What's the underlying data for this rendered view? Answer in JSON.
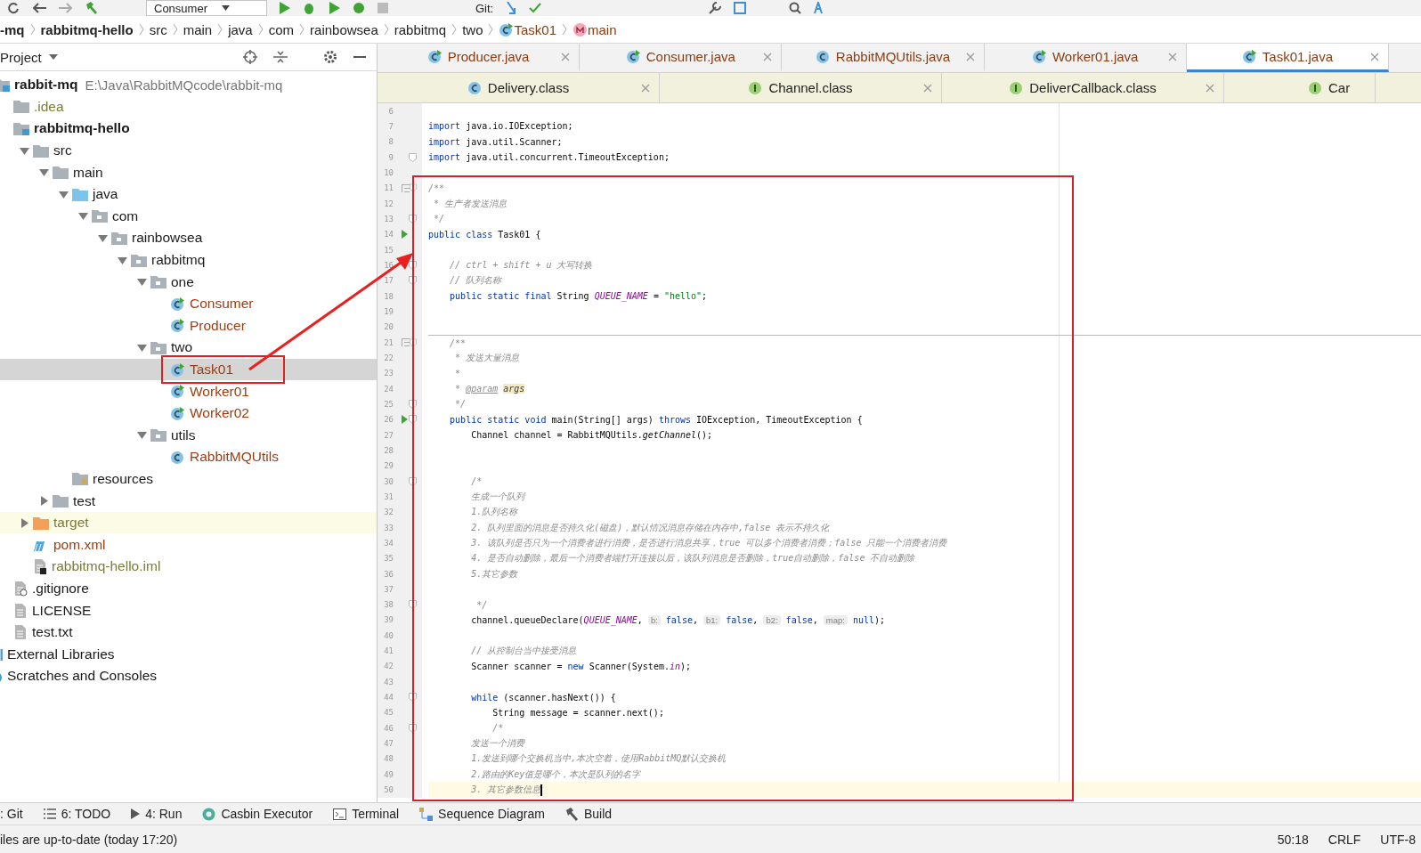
{
  "toolbar": {
    "run_config": "Consumer",
    "vcs_label": "Git:"
  },
  "breadcrumbs": [
    {
      "label": "-mq",
      "kind": "module"
    },
    {
      "label": "rabbitmq-hello",
      "kind": "module"
    },
    {
      "label": "src",
      "kind": "folder"
    },
    {
      "label": "main",
      "kind": "folder"
    },
    {
      "label": "java",
      "kind": "folder"
    },
    {
      "label": "com",
      "kind": "folder"
    },
    {
      "label": "rainbowsea",
      "kind": "folder"
    },
    {
      "label": "rabbitmq",
      "kind": "folder"
    },
    {
      "label": "two",
      "kind": "folder"
    },
    {
      "label": "Task01",
      "kind": "class"
    },
    {
      "label": "main",
      "kind": "method"
    }
  ],
  "project_panel": {
    "title": "Project",
    "tree": [
      {
        "name": "rabbit-mq",
        "kind": "module",
        "path": "E:\\Java\\RabbitMQcode\\rabbit-mq",
        "bold": true,
        "color": "#1a1a1a",
        "selected": false,
        "children": [
          {
            "name": ".idea",
            "kind": "folder",
            "color": "#7c7a3a",
            "selected": false
          },
          {
            "name": "rabbitmq-hello",
            "kind": "module",
            "bold": true,
            "color": "#1a1a1a",
            "selected": false,
            "children": [
              {
                "name": "src",
                "kind": "folder",
                "expanded": true,
                "color": "#1a1a1a",
                "selected": false,
                "children": [
                  {
                    "name": "main",
                    "kind": "folder",
                    "expanded": true,
                    "color": "#1a1a1a",
                    "selected": false,
                    "children": [
                      {
                        "name": "java",
                        "kind": "source-folder",
                        "expanded": true,
                        "color": "#1a1a1a",
                        "selected": false,
                        "children": [
                          {
                            "name": "com",
                            "kind": "package",
                            "expanded": true,
                            "color": "#1a1a1a",
                            "selected": false,
                            "children": [
                              {
                                "name": "rainbowsea",
                                "kind": "package",
                                "expanded": true,
                                "color": "#1a1a1a",
                                "selected": false,
                                "children": [
                                  {
                                    "name": "rabbitmq",
                                    "kind": "package",
                                    "expanded": true,
                                    "color": "#1a1a1a",
                                    "selected": false,
                                    "children": [
                                      {
                                        "name": "one",
                                        "kind": "package",
                                        "expanded": true,
                                        "color": "#1a1a1a",
                                        "selected": false,
                                        "children": [
                                          {
                                            "name": "Consumer",
                                            "kind": "class-runnable",
                                            "color": "#9c3d10",
                                            "selected": false
                                          },
                                          {
                                            "name": "Producer",
                                            "kind": "class-runnable",
                                            "color": "#9c3d10",
                                            "selected": false
                                          }
                                        ]
                                      },
                                      {
                                        "name": "two",
                                        "kind": "package",
                                        "expanded": true,
                                        "color": "#1a1a1a",
                                        "selected": false,
                                        "children": [
                                          {
                                            "name": "Task01",
                                            "kind": "class-runnable",
                                            "color": "#9c3d10",
                                            "selected": true
                                          },
                                          {
                                            "name": "Worker01",
                                            "kind": "class-runnable",
                                            "color": "#9c3d10",
                                            "selected": false
                                          },
                                          {
                                            "name": "Worker02",
                                            "kind": "class-runnable",
                                            "color": "#9c3d10",
                                            "selected": false
                                          }
                                        ]
                                      },
                                      {
                                        "name": "utils",
                                        "kind": "package",
                                        "expanded": true,
                                        "color": "#1a1a1a",
                                        "selected": false,
                                        "children": [
                                          {
                                            "name": "RabbitMQUtils",
                                            "kind": "class",
                                            "color": "#9c3d10",
                                            "selected": false
                                          }
                                        ]
                                      }
                                    ]
                                  }
                                ]
                              }
                            ]
                          }
                        ]
                      },
                      {
                        "name": "resources",
                        "kind": "resources",
                        "color": "#1a1a1a",
                        "selected": false
                      }
                    ]
                  },
                  {
                    "name": "test",
                    "kind": "folder",
                    "expanded": false,
                    "color": "#1a1a1a",
                    "selected": false
                  }
                ]
              },
              {
                "name": "target",
                "kind": "excluded-folder",
                "expanded": false,
                "color": "#7c7a3a",
                "selected": false
              },
              {
                "name": "pom.xml",
                "kind": "maven",
                "color": "#9c3d10",
                "selected": false
              },
              {
                "name": "rabbitmq-hello.iml",
                "kind": "iml",
                "color": "#7c7a3a",
                "selected": false
              }
            ]
          },
          {
            "name": ".gitignore",
            "kind": "gitignore",
            "color": "#1a1a1a",
            "selected": false
          },
          {
            "name": "LICENSE",
            "kind": "text",
            "color": "#1a1a1a",
            "selected": false
          },
          {
            "name": "test.txt",
            "kind": "text",
            "color": "#1a1a1a",
            "selected": false
          }
        ]
      },
      {
        "name": "External Libraries",
        "kind": "library",
        "color": "#1a1a1a",
        "selected": false
      },
      {
        "name": "Scratches and Consoles",
        "kind": "scratches",
        "color": "#1a1a1a",
        "selected": false
      }
    ]
  },
  "editor_tabs": [
    {
      "label": "Producer.java",
      "kind": "runnable",
      "selected": false
    },
    {
      "label": "Consumer.java",
      "kind": "runnable",
      "selected": false
    },
    {
      "label": "RabbitMQUtils.java",
      "kind": "class",
      "selected": false
    },
    {
      "label": "Worker01.java",
      "kind": "runnable",
      "selected": false
    },
    {
      "label": "Task01.java",
      "kind": "runnable",
      "selected": true
    }
  ],
  "library_tabs": [
    {
      "label": "Delivery.class",
      "kind": "class"
    },
    {
      "label": "Channel.class",
      "kind": "interface"
    },
    {
      "label": "DeliverCallback.class",
      "kind": "interface"
    },
    {
      "label": "Car",
      "kind": "interface"
    }
  ],
  "code_lines": [
    {
      "number": "6"
    },
    {
      "number": "7",
      "segments": [
        {
          "kind": "keyword",
          "text": "import"
        },
        {
          "kind": "plain",
          "text": " java.io.IOException;"
        }
      ]
    },
    {
      "number": "8",
      "segments": [
        {
          "kind": "keyword",
          "text": "import"
        },
        {
          "kind": "plain",
          "text": " java.util.Scanner;"
        }
      ]
    },
    {
      "number": "9",
      "markers": [
        {
          "kind": "fold"
        }
      ],
      "segments": [
        {
          "kind": "keyword",
          "text": "import"
        },
        {
          "kind": "plain",
          "text": " java.util.concurrent.TimeoutException;"
        }
      ]
    },
    {
      "number": "10"
    },
    {
      "number": "11",
      "markers": [
        {
          "kind": "doc"
        },
        {
          "kind": "fold"
        }
      ],
      "segments": [
        {
          "kind": "comment",
          "text": "/**"
        }
      ]
    },
    {
      "number": "12",
      "segments": [
        {
          "kind": "comment",
          "text": " * 生产者发送消息"
        }
      ]
    },
    {
      "number": "13",
      "markers": [
        {
          "kind": "fold"
        }
      ],
      "segments": [
        {
          "kind": "comment",
          "text": " */"
        }
      ]
    },
    {
      "number": "14",
      "markers": [
        {
          "kind": "run"
        }
      ],
      "segments": [
        {
          "kind": "keyword",
          "text": "public class"
        },
        {
          "kind": "plain",
          "text": " Task01 {"
        }
      ]
    },
    {
      "number": "15"
    },
    {
      "number": "16",
      "markers": [
        {
          "kind": "fold"
        }
      ],
      "segments": [
        {
          "kind": "comment",
          "text": "    // ctrl + shift + u 大写转换"
        }
      ]
    },
    {
      "number": "17",
      "markers": [
        {
          "kind": "fold"
        }
      ],
      "segments": [
        {
          "kind": "comment",
          "text": "    // 队列名称"
        }
      ]
    },
    {
      "number": "18",
      "segments": [
        {
          "kind": "keyword",
          "text": "    public static final"
        },
        {
          "kind": "plain",
          "text": " String "
        },
        {
          "kind": "constant",
          "text": "QUEUE_NAME"
        },
        {
          "kind": "plain",
          "text": " = "
        },
        {
          "kind": "string",
          "text": "\"hello\""
        },
        {
          "kind": "plain",
          "text": ";"
        }
      ]
    },
    {
      "number": "19"
    },
    {
      "number": "20"
    },
    {
      "number": "21",
      "markers": [
        {
          "kind": "separator"
        },
        {
          "kind": "doc"
        },
        {
          "kind": "fold"
        }
      ],
      "segments": [
        {
          "kind": "comment",
          "text": "    /**"
        }
      ]
    },
    {
      "number": "22",
      "segments": [
        {
          "kind": "comment",
          "text": "     * 发送大量消息"
        }
      ]
    },
    {
      "number": "23",
      "segments": [
        {
          "kind": "comment",
          "text": "     *"
        }
      ]
    },
    {
      "number": "24",
      "segments": [
        {
          "kind": "comment",
          "text": "     * "
        },
        {
          "kind": "doctag",
          "text": "@param"
        },
        {
          "kind": "param",
          "text": "args"
        }
      ]
    },
    {
      "number": "25",
      "markers": [
        {
          "kind": "fold"
        }
      ],
      "segments": [
        {
          "kind": "comment",
          "text": "     */"
        }
      ]
    },
    {
      "number": "26",
      "markers": [
        {
          "kind": "run"
        },
        {
          "kind": "fold"
        }
      ],
      "segments": [
        {
          "kind": "keyword",
          "text": "    public static void"
        },
        {
          "kind": "plain",
          "text": " main(String[] args) "
        },
        {
          "kind": "keyword",
          "text": "throws"
        },
        {
          "kind": "plain",
          "text": " IOException, TimeoutException {"
        }
      ]
    },
    {
      "number": "27",
      "segments": [
        {
          "kind": "plain",
          "text": "        Channel channel = RabbitMQUtils."
        },
        {
          "kind": "method",
          "text": "getChannel"
        },
        {
          "kind": "plain",
          "text": "();"
        }
      ]
    },
    {
      "number": "28"
    },
    {
      "number": "29"
    },
    {
      "number": "30",
      "markers": [
        {
          "kind": "fold"
        }
      ],
      "segments": [
        {
          "kind": "comment",
          "text": "        /*"
        }
      ]
    },
    {
      "number": "31",
      "segments": [
        {
          "kind": "comment",
          "text": "        生成一个队列"
        }
      ]
    },
    {
      "number": "32",
      "segments": [
        {
          "kind": "comment",
          "text": "        1.队列名称"
        }
      ]
    },
    {
      "number": "33",
      "segments": [
        {
          "kind": "comment",
          "text": "        2. 队列里面的消息是否持久化(磁盘)，默认情况消息存储在内存中,false 表示不持久化"
        }
      ]
    },
    {
      "number": "34",
      "segments": [
        {
          "kind": "comment",
          "text": "        3. 该队列是否只为一个消费者进行消费，是否进行消息共享，true 可以多个消费者消费；false 只能一个消费者消费"
        }
      ]
    },
    {
      "number": "35",
      "segments": [
        {
          "kind": "comment",
          "text": "        4. 是否自动删除，最后一个消费者端打开连接以后，该队列消息是否删除，true自动删除，false 不自动删除"
        }
      ]
    },
    {
      "number": "36",
      "segments": [
        {
          "kind": "comment",
          "text": "        5.其它参数"
        }
      ]
    },
    {
      "number": "37"
    },
    {
      "number": "38",
      "markers": [
        {
          "kind": "fold"
        }
      ],
      "segments": [
        {
          "kind": "comment",
          "text": "         */"
        }
      ]
    },
    {
      "number": "39",
      "segments": [
        {
          "kind": "plain",
          "text": "        channel.queueDeclare("
        },
        {
          "kind": "constant",
          "text": "QUEUE_NAME"
        },
        {
          "kind": "plain",
          "text": ", "
        },
        {
          "kind": "hint",
          "text": "b:"
        },
        {
          "kind": "keyword",
          "text": " false"
        },
        {
          "kind": "plain",
          "text": ", "
        },
        {
          "kind": "hint",
          "text": "b1:"
        },
        {
          "kind": "keyword",
          "text": " false"
        },
        {
          "kind": "plain",
          "text": ", "
        },
        {
          "kind": "hint",
          "text": "b2:"
        },
        {
          "kind": "keyword",
          "text": " false"
        },
        {
          "kind": "plain",
          "text": ", "
        },
        {
          "kind": "hint",
          "text": "map:"
        },
        {
          "kind": "keyword",
          "text": " null"
        },
        {
          "kind": "plain",
          "text": ");"
        }
      ]
    },
    {
      "number": "40"
    },
    {
      "number": "41",
      "segments": [
        {
          "kind": "comment",
          "text": "        // 从控制台当中接受消息"
        }
      ]
    },
    {
      "number": "42",
      "segments": [
        {
          "kind": "plain",
          "text": "        Scanner scanner = "
        },
        {
          "kind": "keyword",
          "text": "new"
        },
        {
          "kind": "plain",
          "text": " Scanner(System."
        },
        {
          "kind": "field",
          "text": "in"
        },
        {
          "kind": "plain",
          "text": ");"
        }
      ]
    },
    {
      "number": "43"
    },
    {
      "number": "44",
      "markers": [
        {
          "kind": "fold"
        }
      ],
      "segments": [
        {
          "kind": "keyword",
          "text": "        while"
        },
        {
          "kind": "plain",
          "text": " (scanner.hasNext()) {"
        }
      ]
    },
    {
      "number": "45",
      "segments": [
        {
          "kind": "plain",
          "text": "            String message = scanner.next();"
        }
      ]
    },
    {
      "number": "46",
      "markers": [
        {
          "kind": "fold"
        }
      ],
      "segments": [
        {
          "kind": "comment",
          "text": "            /*"
        }
      ]
    },
    {
      "number": "47",
      "segments": [
        {
          "kind": "comment",
          "text": "        发送一个消费"
        }
      ]
    },
    {
      "number": "48",
      "segments": [
        {
          "kind": "comment",
          "text": "        1.发送到哪个交换机当中,本次空着，使用RabbitMQ默认交换机"
        }
      ]
    },
    {
      "number": "49",
      "segments": [
        {
          "kind": "comment",
          "text": "        2.路由的Key值是哪个，本次是队列的名字"
        }
      ]
    },
    {
      "number": "50",
      "markers": [
        {
          "kind": "current"
        }
      ],
      "segments": [
        {
          "kind": "comment",
          "text": "        3. 其它参数信息"
        }
      ]
    }
  ],
  "tool_windows": [
    {
      "label": ": Git",
      "kind": "git"
    },
    {
      "label": "6: TODO",
      "kind": "list"
    },
    {
      "label": "4: Run",
      "kind": "run"
    },
    {
      "label": "Casbin Executor",
      "kind": "casbin"
    },
    {
      "label": "Terminal",
      "kind": "terminal"
    },
    {
      "label": "Sequence Diagram",
      "kind": "diagram"
    },
    {
      "label": "Build",
      "kind": "hammer"
    }
  ],
  "status_bar": {
    "message": "iles are up-to-date (today 17:20)",
    "position": "50:18",
    "line_separator": "CRLF",
    "encoding": "UTF-8"
  }
}
